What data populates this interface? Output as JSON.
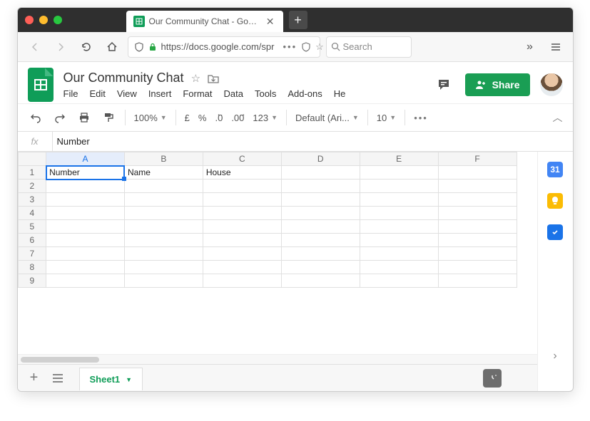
{
  "browser": {
    "tab_title": "Our Community Chat - Google S",
    "url": "https://docs.google.com/spr",
    "search_placeholder": "Search"
  },
  "doc": {
    "title": "Our Community Chat",
    "menu": [
      "File",
      "Edit",
      "View",
      "Insert",
      "Format",
      "Data",
      "Tools",
      "Add-ons",
      "He"
    ],
    "share_label": "Share"
  },
  "toolbar": {
    "zoom": "100%",
    "currency": "£",
    "percent": "%",
    "dec_dec": ".0",
    "dec_inc": ".00",
    "more_formats": "123",
    "font": "Default (Ari...",
    "fontsize": "10"
  },
  "formula_bar": {
    "fx": "fx",
    "value": "Number"
  },
  "sheet": {
    "columns": [
      "A",
      "B",
      "C",
      "D",
      "E",
      "F"
    ],
    "rows": [
      "1",
      "2",
      "3",
      "4",
      "5",
      "6",
      "7",
      "8",
      "9"
    ],
    "cells": {
      "A1": "Number",
      "B1": "Name",
      "C1": "House"
    },
    "selected": "A1"
  },
  "tabs": {
    "sheet1": "Sheet1"
  },
  "sidepanel": {
    "calendar": "31"
  }
}
